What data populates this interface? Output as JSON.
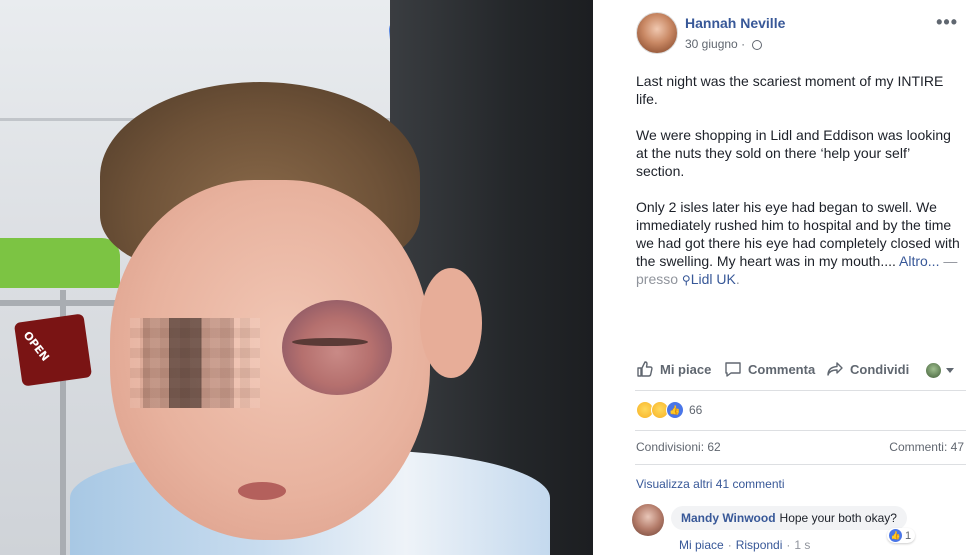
{
  "post": {
    "author": "Hannah Neville",
    "date": "30 giugno",
    "date_separator": "·",
    "more_icon": "•••",
    "paragraphs": [
      "Last night was the scariest moment of my INTIRE life.",
      "We were shopping in Lidl and Eddison was looking at the nuts they sold on there ‘help your self’ section.",
      "Only 2 isles later his eye had began to swell. We immediately rushed him to hospital and by the time we had got there his eye had completely closed with the swelling. My heart was in my mouth...."
    ],
    "see_more": "Altro...",
    "location_prefix": "— presso",
    "location": "Lidl UK",
    "location_suffix": "."
  },
  "photo": {
    "sign_text": "OPEN"
  },
  "actions": {
    "like": "Mi piace",
    "comment": "Commenta",
    "share": "Condividi"
  },
  "reactions": {
    "count": "66",
    "types": [
      "wow",
      "sad",
      "like"
    ]
  },
  "stats": {
    "shares": "Condivisioni: 62",
    "comments": "Commenti: 47"
  },
  "comments": {
    "view_more": "Visualizza altri 41 commenti",
    "items": [
      {
        "author": "Mandy Winwood",
        "text": "Hope your both okay?",
        "like_count": "1",
        "like_action": "Mi piace",
        "reply_action": "Rispondi",
        "separator": "·",
        "time": "1 s"
      }
    ]
  },
  "colors": {
    "link": "#385898",
    "text": "#1d2129",
    "muted": "#616770",
    "like_blue": "#4a76e8"
  }
}
